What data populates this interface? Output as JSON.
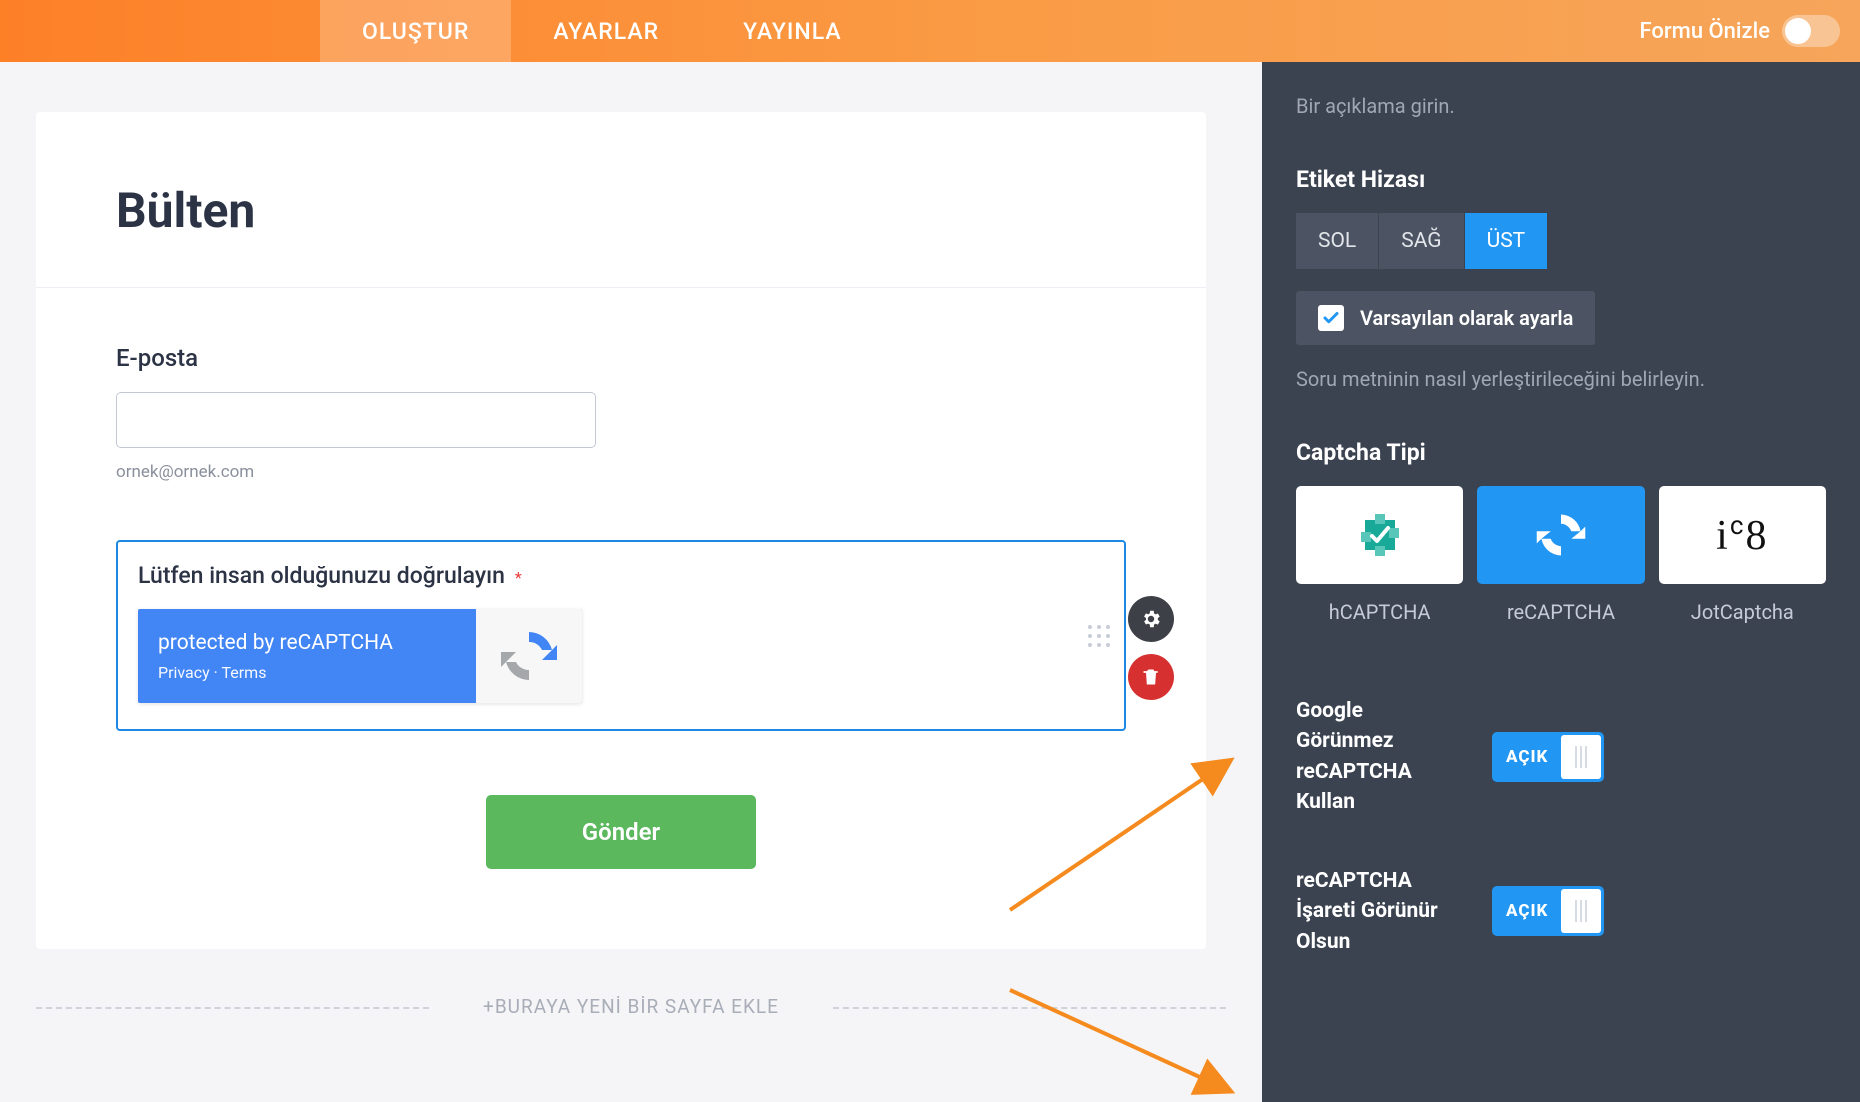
{
  "topbar": {
    "tabs": {
      "build": "OLUŞTUR",
      "settings": "AYARLAR",
      "publish": "YAYINLA"
    },
    "preview_label": "Formu Önizle"
  },
  "form": {
    "title": "Bülten",
    "email_label": "E-posta",
    "email_helper": "ornek@ornek.com",
    "captcha_label": "Lütfen insan olduğunuzu doğrulayın",
    "recaptcha_line1": "protected by reCAPTCHA",
    "recaptcha_line2": "Privacy · Terms",
    "submit_label": "Gönder",
    "add_page": "+BURAYA YENİ BİR SAYFA EKLE"
  },
  "panel": {
    "desc_placeholder": "Bir açıklama girin.",
    "align_heading": "Etiket Hizası",
    "align": {
      "left": "SOL",
      "right": "SAĞ",
      "top": "ÜST"
    },
    "default_checkbox": "Varsayılan olarak ayarla",
    "align_hint": "Soru metninin nasıl yerleştirileceğini belirleyin.",
    "ctype_heading": "Captcha Tipi",
    "ctype_labels": {
      "h": "hCAPTCHA",
      "re": "reCAPTCHA",
      "jot": "JotCaptcha"
    },
    "jot_sample": "i c 8",
    "switch1_label": "Google Görünmez reCAPTCHA Kullan",
    "switch2_label": "reCAPTCHA İşareti Görünür Olsun",
    "switch_on": "AÇIK"
  }
}
